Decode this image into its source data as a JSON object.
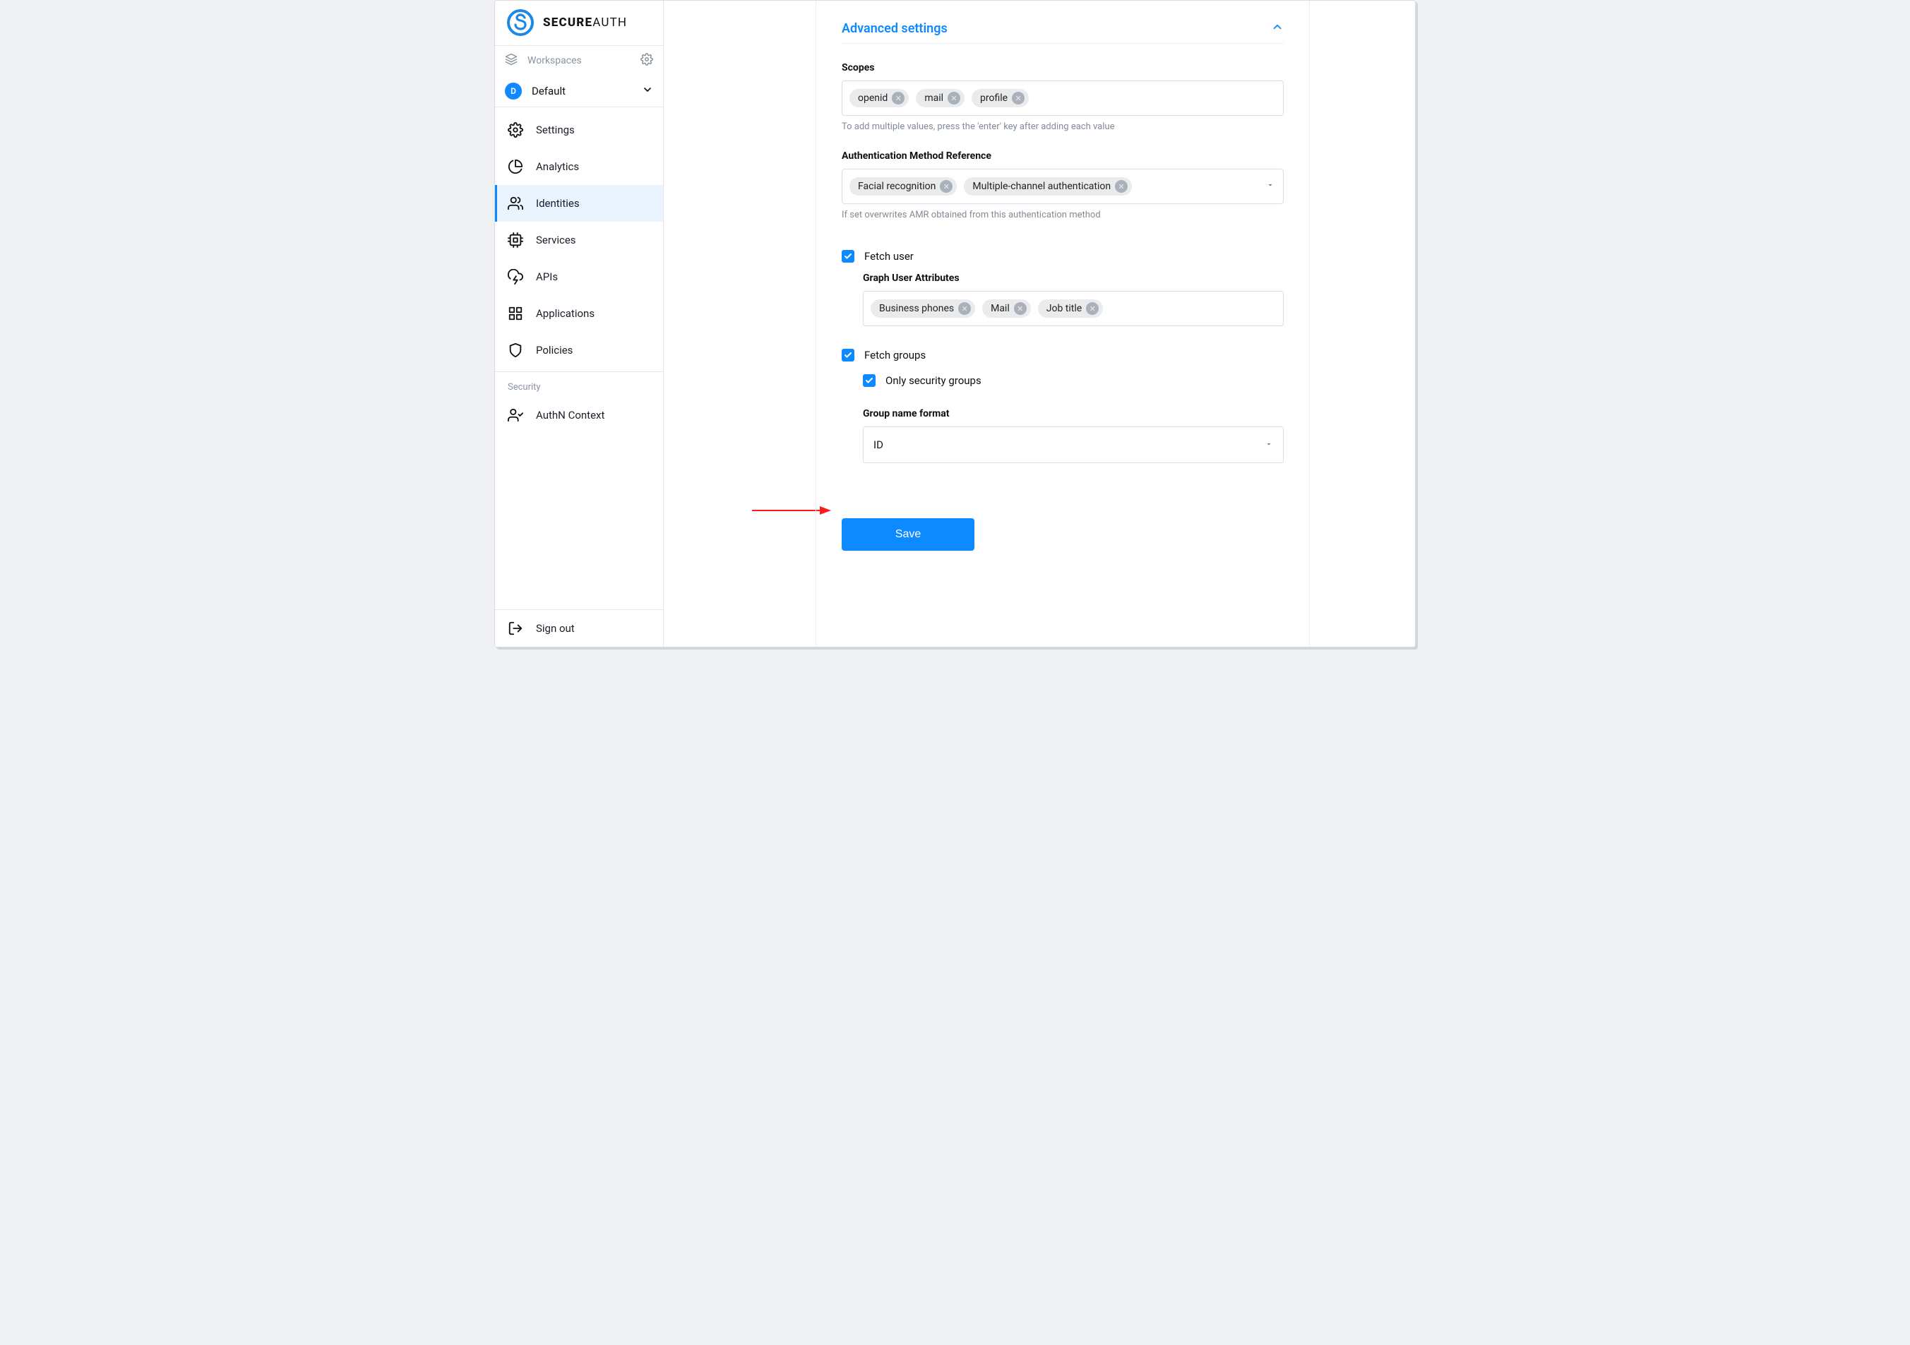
{
  "brand": {
    "name_a": "SECURE",
    "name_b": "AUTH"
  },
  "sidebar": {
    "workspaces_label": "Workspaces",
    "workspace_selected": "Default",
    "workspace_initial": "D",
    "nav": [
      {
        "label": "Settings"
      },
      {
        "label": "Analytics"
      },
      {
        "label": "Identities"
      },
      {
        "label": "Services"
      },
      {
        "label": "APIs"
      },
      {
        "label": "Applications"
      },
      {
        "label": "Policies"
      }
    ],
    "security_section": "Security",
    "authn_context": "AuthN Context",
    "sign_out": "Sign out"
  },
  "panel": {
    "title": "Advanced settings",
    "scopes": {
      "label": "Scopes",
      "chips": [
        "openid",
        "mail",
        "profile"
      ],
      "help": "To add multiple values, press the 'enter' key after adding each value"
    },
    "amr": {
      "label": "Authentication Method Reference",
      "chips": [
        "Facial recognition",
        "Multiple-channel authentication"
      ],
      "help": "If set overwrites AMR obtained from this authentication method"
    },
    "fetch_user": {
      "label": "Fetch user",
      "graph_label": "Graph User Attributes",
      "chips": [
        "Business phones",
        "Mail",
        "Job title"
      ]
    },
    "fetch_groups": {
      "label": "Fetch groups",
      "only_security": "Only security groups",
      "group_name_format_label": "Group name format",
      "group_name_format_value": "ID"
    },
    "save": "Save"
  }
}
